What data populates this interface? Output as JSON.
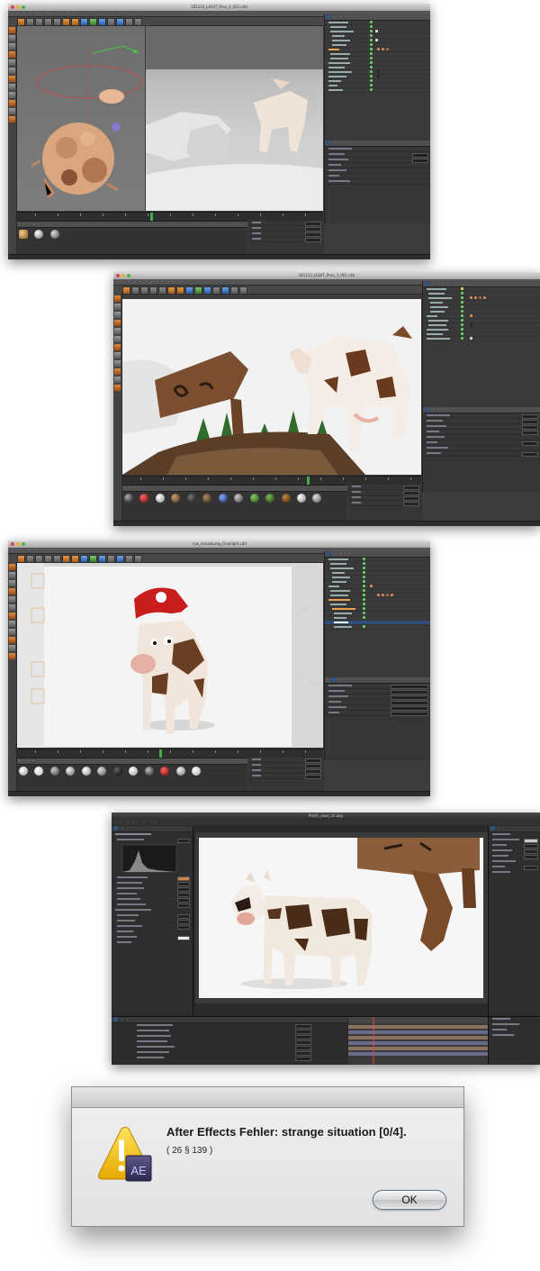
{
  "screenshots": [
    {
      "window_title": "181123_LIGHT_Prev_2_001.c4d"
    },
    {
      "window_title": "181123_LIGHT_Prev_3_001.c4d"
    },
    {
      "window_title": "cow_xmasbump_Finallight.c4d"
    },
    {
      "window_title": "finish_cows_sh.aep"
    }
  ],
  "dialog": {
    "title": "After Effects Fehler: strange situation [0/4].",
    "message": "( 26 § 139 )",
    "ok_label": "OK",
    "icon": "after-effects-warning-icon",
    "icon_badge": "AE"
  },
  "colors": {
    "app_bg": "#3c3c3c",
    "selection_blue": "#2f4f7a",
    "timeline_cursor": "#3fb048",
    "warning_yellow": "#f2c200"
  }
}
